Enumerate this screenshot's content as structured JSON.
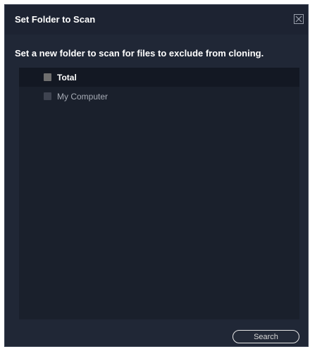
{
  "dialog": {
    "title": "Set Folder to Scan",
    "close_icon": "close-icon",
    "subtitle": "Set a new folder to scan for files to exclude from cloning."
  },
  "tree": {
    "items": [
      {
        "label": "Total",
        "checked": false
      },
      {
        "label": "My Computer",
        "checked": false
      }
    ]
  },
  "footer": {
    "search_label": "Search"
  },
  "colors": {
    "dialog_bg": "#202736",
    "titlebar_bg": "#1d2332",
    "tree_bg": "#1a202c",
    "selected_row_bg": "#131823"
  }
}
